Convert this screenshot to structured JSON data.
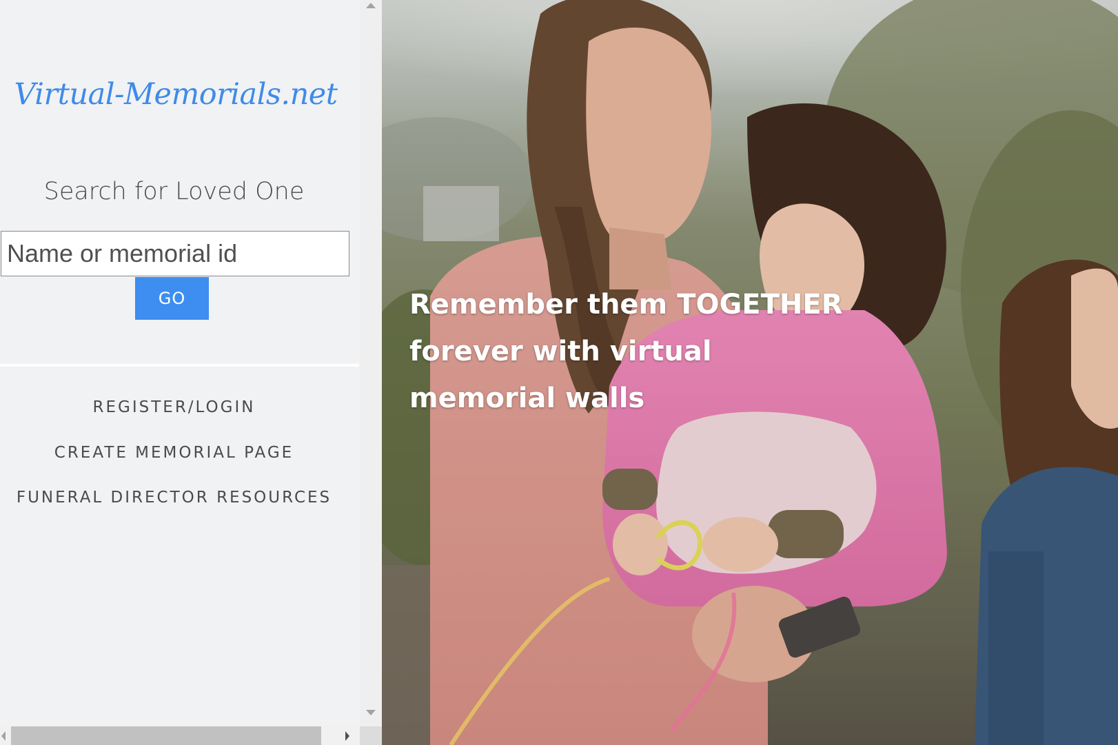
{
  "site": {
    "logo_text": "Virtual-Memorials.net"
  },
  "search": {
    "heading": "Search for Loved One",
    "placeholder": "Name or memorial id",
    "value": "",
    "go_label": "GO"
  },
  "nav": {
    "items": [
      {
        "label": "REGISTER/LOGIN"
      },
      {
        "label": "CREATE MEMORIAL PAGE"
      },
      {
        "label": "FUNERAL DIRECTOR RESOURCES"
      }
    ]
  },
  "hero": {
    "tagline": "Remember them TOGETHER forever with virtual memorial walls",
    "image_subject": "mother-and-children-photo"
  },
  "colors": {
    "sidebar_bg": "#f1f2f4",
    "logo": "#3f8be8",
    "go_button": "#3d8ef0",
    "nav_text": "#4a4a4a",
    "tagline": "#ffffff"
  }
}
